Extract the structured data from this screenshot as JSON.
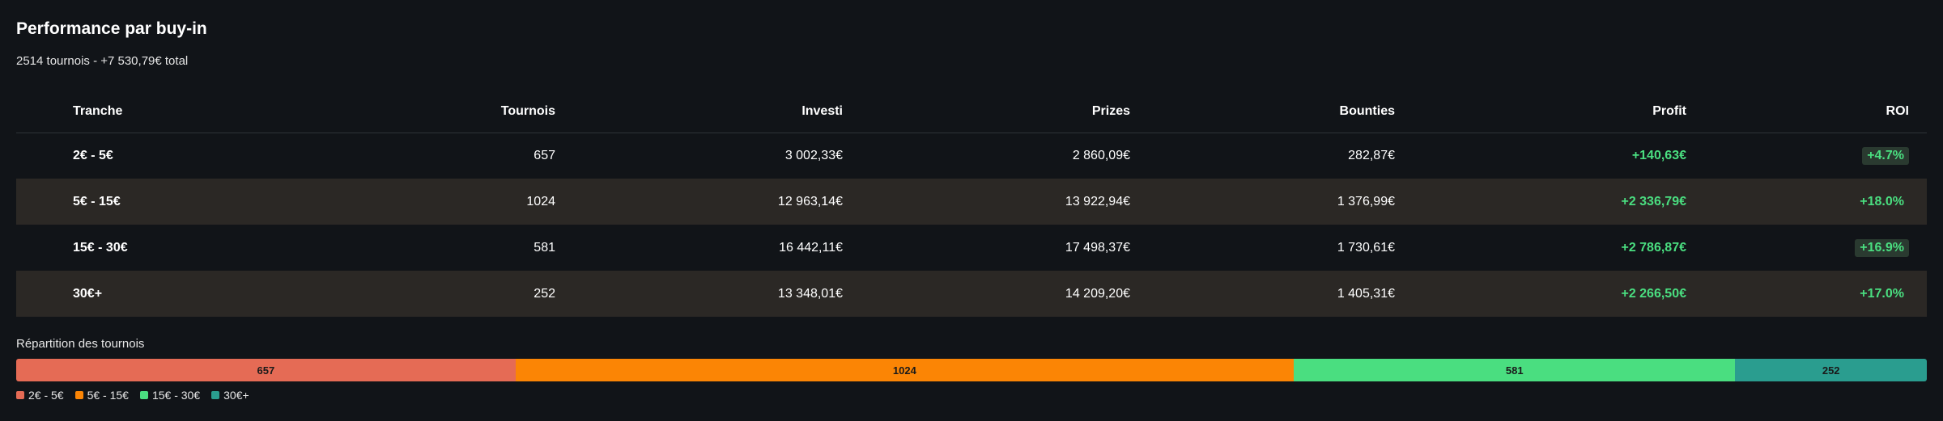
{
  "header": {
    "title": "Performance par buy-in",
    "subtitle": "2514 tournois - +7 530,79€ total"
  },
  "table": {
    "columns": [
      "Tranche",
      "Tournois",
      "Investi",
      "Prizes",
      "Bounties",
      "Profit",
      "ROI"
    ],
    "rows": [
      {
        "tranche": "2€ - 5€",
        "tournois": "657",
        "investi": "3 002,33€",
        "prizes": "2 860,09€",
        "bounties": "282,87€",
        "profit": "+140,63€",
        "roi": "+4.7%"
      },
      {
        "tranche": "5€ - 15€",
        "tournois": "1024",
        "investi": "12 963,14€",
        "prizes": "13 922,94€",
        "bounties": "1 376,99€",
        "profit": "+2 336,79€",
        "roi": "+18.0%"
      },
      {
        "tranche": "15€ - 30€",
        "tournois": "581",
        "investi": "16 442,11€",
        "prizes": "17 498,37€",
        "bounties": "1 730,61€",
        "profit": "+2 786,87€",
        "roi": "+16.9%"
      },
      {
        "tranche": "30€+",
        "tournois": "252",
        "investi": "13 348,01€",
        "prizes": "14 209,20€",
        "bounties": "1 405,31€",
        "profit": "+2 266,50€",
        "roi": "+17.0%"
      }
    ]
  },
  "distribution": {
    "label": "Répartition des tournois",
    "segments": [
      {
        "name": "2€ - 5€",
        "count": 657,
        "count_label": "657",
        "color": "#e56b55"
      },
      {
        "name": "5€ - 15€",
        "count": 1024,
        "count_label": "1024",
        "color": "#fb8505"
      },
      {
        "name": "15€ - 30€",
        "count": 581,
        "count_label": "581",
        "color": "#4ade80"
      },
      {
        "name": "30€+",
        "count": 252,
        "count_label": "252",
        "color": "#2a9d8f"
      }
    ]
  },
  "colors": {
    "background": "#111418",
    "row_alt": "#2b2825",
    "positive": "#4ade80",
    "roi_badge": "#2a3a30"
  }
}
